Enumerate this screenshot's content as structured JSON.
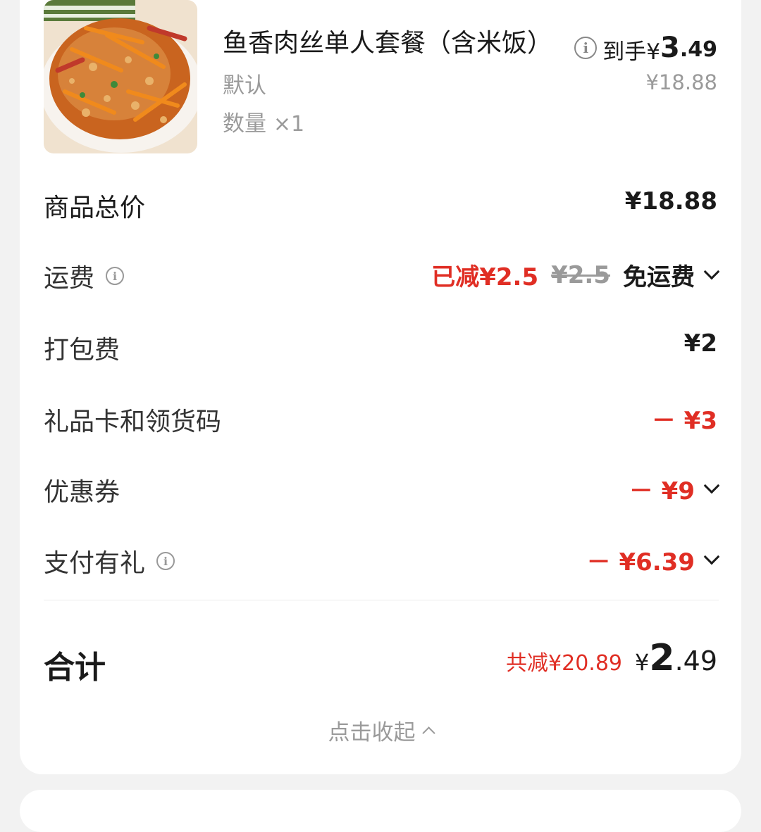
{
  "product": {
    "name": "鱼香肉丝单人套餐（含米饭）",
    "spec": "默认",
    "qty_label": "数量",
    "qty_value": "×1",
    "final_price_label": "到手¥",
    "final_price_int": "3",
    "final_price_dec": ".49",
    "original_price": "¥18.88"
  },
  "rows": {
    "subtotal": {
      "label": "商品总价",
      "value": "¥18.88"
    },
    "shipping": {
      "label": "运费",
      "reduced": "已减¥2.5",
      "original": "¥2.5",
      "value": "免运费"
    },
    "packing": {
      "label": "打包费",
      "value": "¥2"
    },
    "giftcard": {
      "label": "礼品卡和领货码",
      "value": "－ ¥3"
    },
    "coupon": {
      "label": "优惠券",
      "value": "－ ¥9"
    },
    "payment": {
      "label": "支付有礼",
      "value": "－ ¥6.39"
    }
  },
  "total": {
    "label": "合计",
    "saved": "共减¥20.89",
    "yen": "¥",
    "int": "2",
    "dec": ".49"
  },
  "collapse_label": "点击收起",
  "colors": {
    "accent_red": "#e02e24",
    "muted": "#9a9a9a"
  }
}
